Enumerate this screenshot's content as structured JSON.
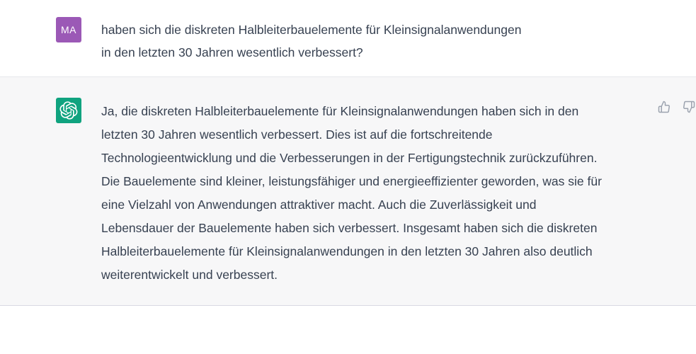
{
  "user_message": {
    "avatar_initials": "MA",
    "text": "haben sich die diskreten Halbleiterbauelemente für Kleinsignalanwendungen\nin den letzten 30 Jahren wesentlich verbessert?"
  },
  "assistant_message": {
    "avatar_icon": "openai-logo-icon",
    "text": "Ja, die diskreten Halbleiterbauelemente für Kleinsignalanwendungen haben sich in den\nletzten 30 Jahren wesentlich verbessert. Dies ist auf die fortschreitende\nTechnologieentwicklung und die Verbesserungen in der Fertigungstechnik zurückzuführen.\nDie Bauelemente sind kleiner, leistungsfähiger und energieeffizienter geworden, was sie für\neine Vielzahl von Anwendungen attraktiver macht. Auch die Zuverlässigkeit und\nLebensdauer der Bauelemente haben sich verbessert. Insgesamt haben sich die diskreten\nHalbleiterbauelemente für Kleinsignalanwendungen in den letzten 30 Jahren also deutlich\nweiterentwickelt und verbessert.",
    "feedback_icons": [
      "thumbs-up-icon",
      "thumbs-down-icon"
    ]
  },
  "colors": {
    "user_avatar_bg": "#9b59b6",
    "bot_avatar_bg": "#10a37f",
    "assistant_row_bg": "#f7f7f8",
    "text": "#374151"
  }
}
